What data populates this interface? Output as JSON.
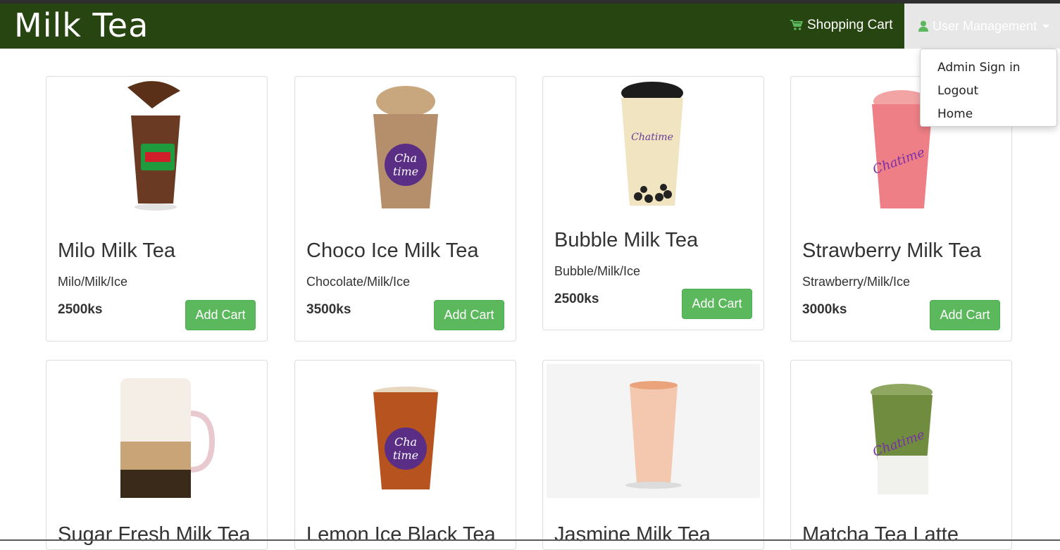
{
  "brand": "Milk Tea",
  "nav": {
    "cart_label": "Shopping Cart",
    "user_label": "User Management"
  },
  "dropdown": [
    "Admin Sign in",
    "Logout",
    "Home"
  ],
  "colors": {
    "navbar": "#274511",
    "button": "#5cb85c",
    "cart_icon": "#5cb85c"
  },
  "products": [
    {
      "name": "Milo Milk Tea",
      "ingredients": "Milo/Milk/Ice",
      "price": "2500ks",
      "button": "Add Cart"
    },
    {
      "name": "Choco Ice Milk Tea",
      "ingredients": "Chocolate/Milk/Ice",
      "price": "3500ks",
      "button": "Add Cart"
    },
    {
      "name": "Bubble Milk Tea",
      "ingredients": "Bubble/Milk/Ice",
      "price": "2500ks",
      "button": "Add Cart"
    },
    {
      "name": "Strawberry Milk Tea",
      "ingredients": "Strawberry/Milk/Ice",
      "price": "3000ks",
      "button": "Add Cart"
    },
    {
      "name": "Sugar Fresh Milk Tea"
    },
    {
      "name": "Lemon Ice Black Tea"
    },
    {
      "name": "Jasmine Milk Tea"
    },
    {
      "name": "Matcha Tea Latte"
    }
  ]
}
